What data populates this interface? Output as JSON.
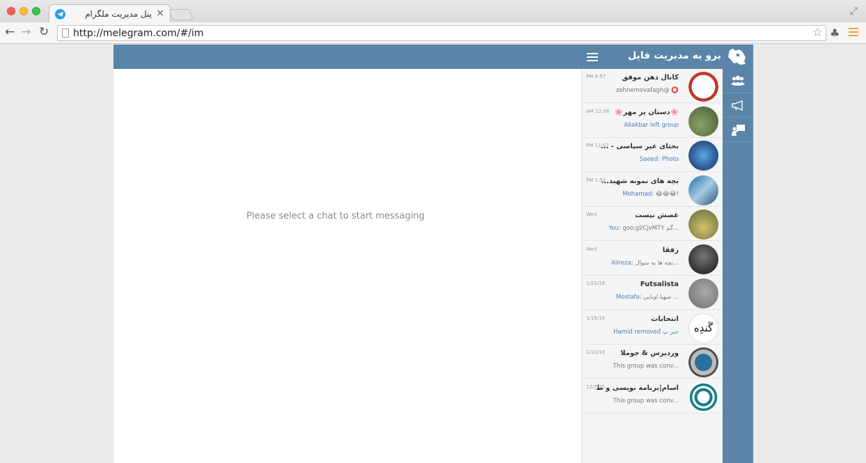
{
  "browser": {
    "tab_title": "پنل مدیریت ملگرام",
    "tab_close": "×",
    "url": "http://melegram.com/#/im"
  },
  "app": {
    "title": "برو به مدیریت فایل",
    "empty_state": "Please select a chat to start messaging",
    "accent_color": "#5a85a9"
  },
  "side_nav": [
    {
      "icon": "contacts-icon"
    },
    {
      "icon": "megaphone-icon"
    },
    {
      "icon": "presentation-icon"
    }
  ],
  "chats": [
    {
      "name": "کانال ذهن موفق",
      "time": "PM 8:57",
      "author": "",
      "message": "zehnemovafagh@ ⭕"
    },
    {
      "name": "🌸دستان پر مهر🌸",
      "time": "AM 12:08",
      "author": "",
      "message": "Aliakbar left group",
      "message_color": "#4a7fb5"
    },
    {
      "name": "بحثای غیر سیاسی - ...",
      "time": "PM 11:57",
      "author": "Saeed:",
      "message": " Photo",
      "message_color": "#4a7fb5"
    },
    {
      "name": "بچه های نمونه شهید...",
      "time": "PM 1:52",
      "author": "Mohamad:",
      "message": " 😂😂😂!"
    },
    {
      "name": "غصش نیست",
      "time": "Wed",
      "author": "You:",
      "message": " goo.gl/CjvMTY گم..."
    },
    {
      "name": "رفقا",
      "time": "Wed",
      "author": "Alireza:",
      "message": " بچه ها یه سوال..."
    },
    {
      "name": "Futsalista",
      "time": "1/21/16",
      "author": "Mostafa:",
      "message": " صهبا اونایی ..."
    },
    {
      "name": "انتخابات",
      "time": "1/16/16",
      "author": "",
      "message": "Hamid removed خبر پ",
      "message_color": "#4a7fb5"
    },
    {
      "name": "وردپرس & جوملا",
      "time": "1/10/16",
      "author": "",
      "message": "This group was conv..."
    },
    {
      "name": "آسام|برنامه نویسی و ط...",
      "time": "12/7/15",
      "author": "",
      "message": "This group was conv..."
    }
  ]
}
